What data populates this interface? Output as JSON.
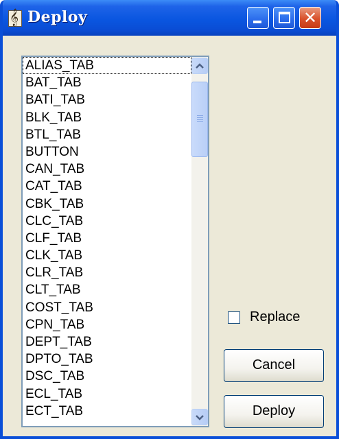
{
  "window": {
    "title": "Deploy",
    "app_icon": "music-note-icon",
    "controls": {
      "minimize_icon": "minimize-icon",
      "maximize_icon": "maximize-icon",
      "close_icon": "close-icon"
    }
  },
  "listbox": {
    "items": [
      "ALIAS_TAB",
      "BAT_TAB",
      "BATI_TAB",
      "BLK_TAB",
      "BTL_TAB",
      "BUTTON",
      "CAN_TAB",
      "CAT_TAB",
      "CBK_TAB",
      "CLC_TAB",
      "CLF_TAB",
      "CLK_TAB",
      "CLR_TAB",
      "CLT_TAB",
      "COST_TAB",
      "CPN_TAB",
      "DEPT_TAB",
      "DPTO_TAB",
      "DSC_TAB",
      "ECL_TAB",
      "ECT_TAB"
    ],
    "focused_index": 0
  },
  "options": {
    "replace_label": "Replace",
    "replace_checked": false
  },
  "buttons": {
    "cancel_label": "Cancel",
    "deploy_label": "Deploy"
  },
  "colors": {
    "titlebar": "#0A56E0",
    "window_bg": "#ECE9D8",
    "close_button": "#D9512C",
    "list_border": "#7F9DB9"
  }
}
